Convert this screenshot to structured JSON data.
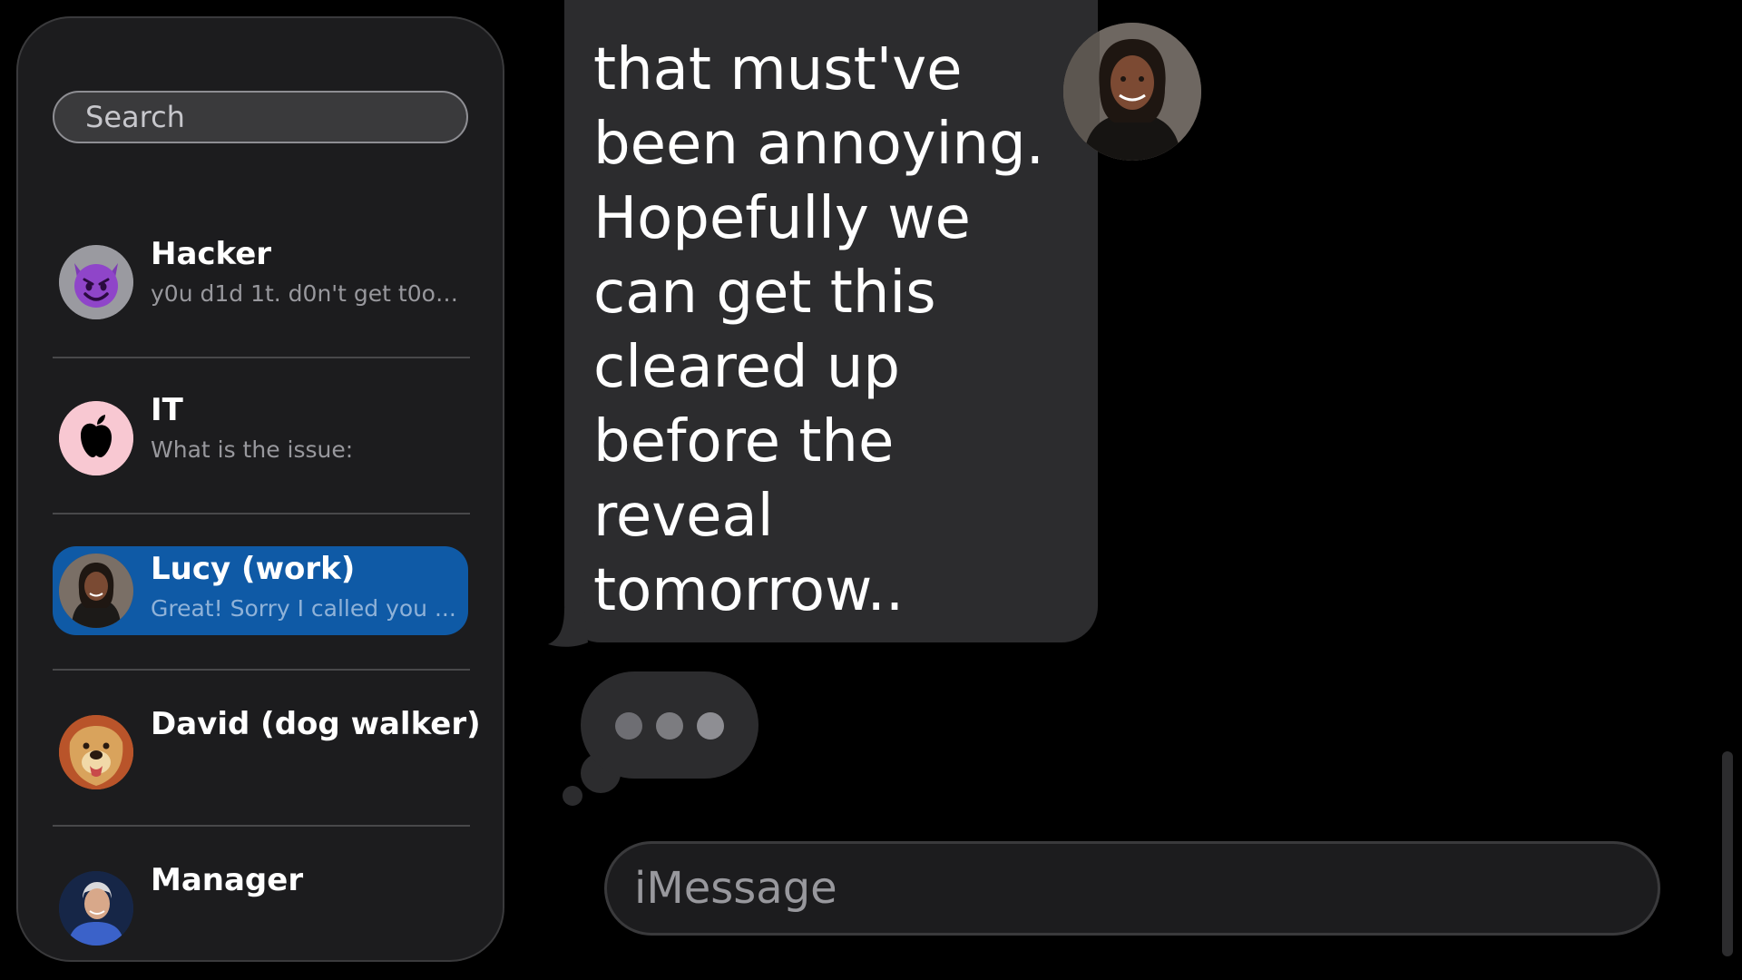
{
  "sidebar": {
    "search_placeholder": "Search",
    "contacts": [
      {
        "name": "Hacker",
        "preview": "y0u d1d 1t. d0n't get t0o ...",
        "avatar_icon": "devil-emoji-icon"
      },
      {
        "name": "IT",
        "preview": "What is the issue:",
        "avatar_icon": "apple-logo-icon"
      },
      {
        "name": "Lucy (work)",
        "preview": "Great! Sorry I called you ...",
        "avatar_icon": "lucy-photo",
        "selected": true
      },
      {
        "name": "David (dog walker)",
        "preview": "",
        "avatar_icon": "dog-photo"
      },
      {
        "name": "Manager",
        "preview": "",
        "avatar_icon": "manager-photo"
      }
    ]
  },
  "chat": {
    "message_text": "that must've\nbeen annoying.\nHopefully we\ncan get this\ncleared up\nbefore the\nreveal\ntomorrow..",
    "typing_indicator": "typing-dots-icon",
    "compose_placeholder": "iMessage"
  },
  "colors": {
    "background": "#000000",
    "sidebar": "#1c1c1e",
    "selected": "#0f5aa6",
    "bubble": "#2c2c2e"
  }
}
